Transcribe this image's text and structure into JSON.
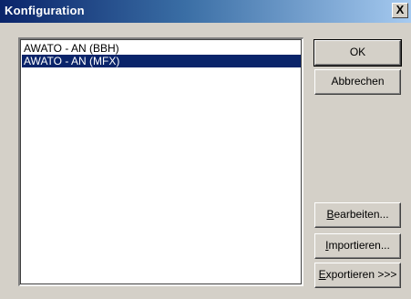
{
  "window": {
    "title": "Konfiguration",
    "close_glyph": "X"
  },
  "list": {
    "items": [
      {
        "label": "AWATO - AN (BBH)",
        "selected": false
      },
      {
        "label": "AWATO - AN (MFX)",
        "selected": true
      }
    ]
  },
  "buttons": {
    "ok": "OK",
    "cancel": "Abbrechen",
    "edit_mnemonic": "B",
    "edit_rest": "earbeiten...",
    "import_mnemonic": "I",
    "import_rest": "mportieren...",
    "export_mnemonic": "E",
    "export_rest": "xportieren >>>"
  },
  "colors": {
    "selection": "#0a246a",
    "title_bar_start": "#0a246a",
    "title_bar_end": "#a6caf0",
    "dialog_face": "#d4d0c8"
  }
}
